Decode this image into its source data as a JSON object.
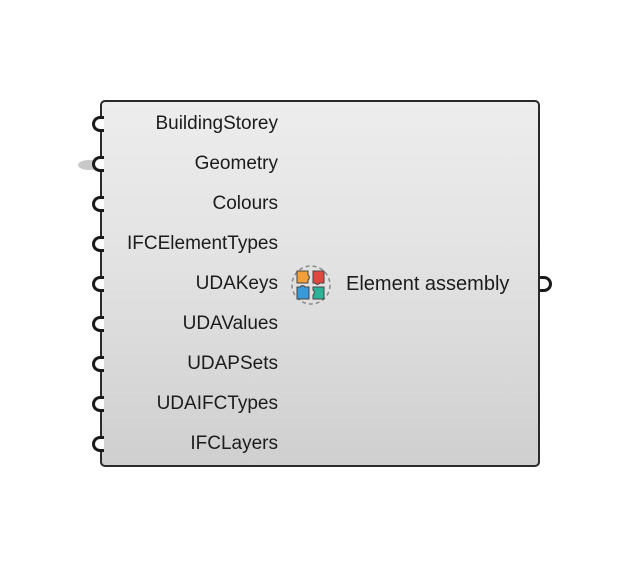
{
  "component": {
    "name": "Element assembly",
    "icon": "puzzle-pieces-icon",
    "inputs": [
      {
        "label": "BuildingStorey"
      },
      {
        "label": "Geometry"
      },
      {
        "label": "Colours"
      },
      {
        "label": "IFCElementTypes"
      },
      {
        "label": "UDAKeys"
      },
      {
        "label": "UDAValues"
      },
      {
        "label": "UDAPSets"
      },
      {
        "label": "UDAIFCTypes"
      },
      {
        "label": "IFCLayers"
      }
    ]
  },
  "colors": {
    "piece_orange": "#f2a13a",
    "piece_red": "#e2473f",
    "piece_blue": "#3a9ad9",
    "piece_teal": "#2bb39a"
  }
}
